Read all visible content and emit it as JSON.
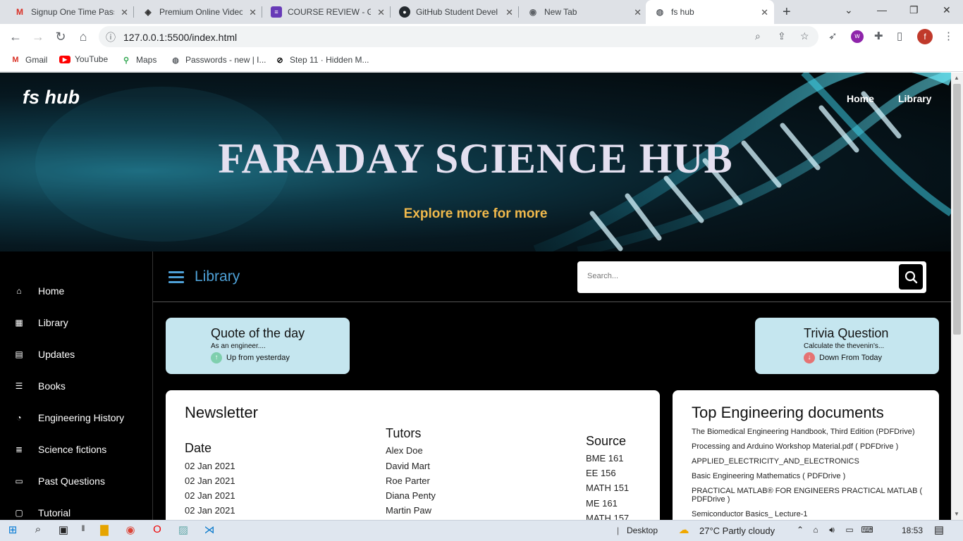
{
  "browser": {
    "tabs": [
      {
        "title": "Signup One Time Pass",
        "icon": "gmail-icon"
      },
      {
        "title": "Premium Online Video",
        "icon": "diamond-icon"
      },
      {
        "title": "COURSE REVIEW - Go",
        "icon": "forms-icon"
      },
      {
        "title": "GitHub Student Devel",
        "icon": "github-icon"
      },
      {
        "title": "New Tab",
        "icon": "chrome-icon"
      },
      {
        "title": "fs hub",
        "icon": "globe-icon"
      }
    ],
    "url": "127.0.0.1:5500/index.html",
    "profile_letter": "f",
    "bookmarks": [
      {
        "label": "Gmail",
        "icon": "gmail-icon"
      },
      {
        "label": "YouTube",
        "icon": "youtube-icon"
      },
      {
        "label": "Maps",
        "icon": "maps-icon"
      },
      {
        "label": "Passwords - new | I...",
        "icon": "globe-icon"
      },
      {
        "label": "Step 11 · Hidden M...",
        "icon": "step-icon"
      }
    ]
  },
  "site": {
    "brand": "fs hub",
    "nav": [
      "Home",
      "Library"
    ],
    "hero_title": "FARADAY SCIENCE HUB",
    "hero_subtitle": "Explore more for more",
    "accent_color": "#f0b94c",
    "sidebar": [
      "Home",
      "Library",
      "Updates",
      "Books",
      "Engineering History",
      "Science fictions",
      "Past Questions",
      "Tutorial"
    ],
    "library_title": "Library",
    "search_placeholder": "Search...",
    "quote_card": {
      "title": "Quote of the day",
      "text": "As an engineer....",
      "trend": "Up from yesterday"
    },
    "trivia_card": {
      "title": "Trivia Question",
      "text": "Calculate the thevenin's...",
      "trend": "Down From Today"
    },
    "newsletter": {
      "title": "Newsletter",
      "date_header": "Date",
      "dates": [
        "02 Jan 2021",
        "02 Jan 2021",
        "02 Jan 2021",
        "02 Jan 2021"
      ],
      "tutors_header": "Tutors",
      "tutors": [
        "Alex Doe",
        "David Mart",
        "Roe Parter",
        "Diana Penty",
        "Martin Paw"
      ],
      "source_header": "Source",
      "sources": [
        "BME 161",
        "EE 156",
        "MATH 151",
        "ME 161",
        "MATH 157"
      ]
    },
    "top_docs": {
      "title": "Top Engineering documents",
      "items": [
        "The Biomedical Engineering Handbook, Third Edition (PDFDrive)",
        "Processing and Arduino Workshop Material.pdf ( PDFDrive )",
        "APPLIED_ELECTRICITY_AND_ELECTRONICS",
        "Basic Engineering Mathematics ( PDFDrive )",
        "PRACTICAL MATLAB® FOR ENGINEERS PRACTICAL MATLAB ( PDFDrive )",
        "Semiconductor Basics_ Lecture-1"
      ]
    }
  },
  "taskbar": {
    "desktop_label": "Desktop",
    "weather": "27°C  Partly cloudy",
    "time": "18:53"
  }
}
